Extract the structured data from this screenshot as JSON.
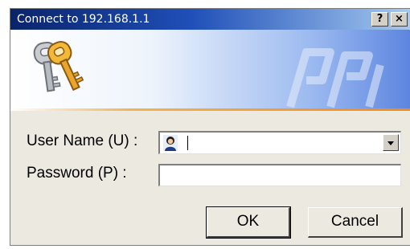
{
  "window": {
    "title": "Connect to 192.168.1.1",
    "help_button": "?",
    "close_button": "×"
  },
  "form": {
    "username": {
      "label": "User Name (U) :",
      "value": ""
    },
    "password": {
      "label": "Password (P) :",
      "value": ""
    }
  },
  "buttons": {
    "ok": "OK",
    "cancel": "Cancel"
  },
  "icons": {
    "banner": "keys-icon",
    "user_field": "user-account-icon",
    "dropdown": "chevron-down-icon"
  },
  "colors": {
    "titlebar_start": "#0a246a",
    "titlebar_end": "#a6caf0",
    "accent_line": "#f08a1c",
    "dialog_bg": "#ece9e1"
  }
}
